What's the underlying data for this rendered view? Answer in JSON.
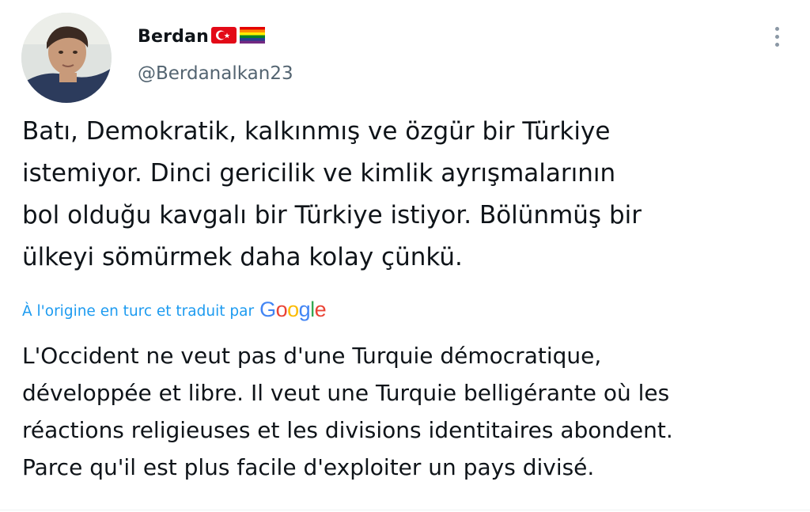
{
  "author": {
    "display_name": "Berdan",
    "emojis": [
      "turkey-flag",
      "rainbow-flag"
    ],
    "handle": "@Berdanalkan23"
  },
  "tweet": {
    "original_text": "Batı, Demokratik, kalkınmış ve özgür bir Türkiye\nistemiyor. Dinci gericilik ve kimlik ayrışmalarının\nbol olduğu kavgalı bir Türkiye istiyor. Bölünmüş bir\nülkeyi sömürmek daha kolay çünkü.",
    "translation_notice": "À l'origine en turc et traduit par",
    "translation_provider": "Google",
    "translated_text": "L'Occident ne veut pas d'une Turquie démocratique,\ndéveloppée et libre. Il veut une Turquie belligérante où les\nréactions religieuses et les divisions identitaires abondent.\nParce qu'il est plus facile d'exploiter un pays divisé."
  },
  "icons": {
    "more": "more-options-icon",
    "avatar": "profile-avatar"
  },
  "colors": {
    "link": "#1d9bf0",
    "secondary_text": "#536471",
    "primary_text": "#0f1419",
    "google_blue": "#4285F4",
    "google_red": "#EA4335",
    "google_yellow": "#FBBC05",
    "google_green": "#34A853"
  }
}
